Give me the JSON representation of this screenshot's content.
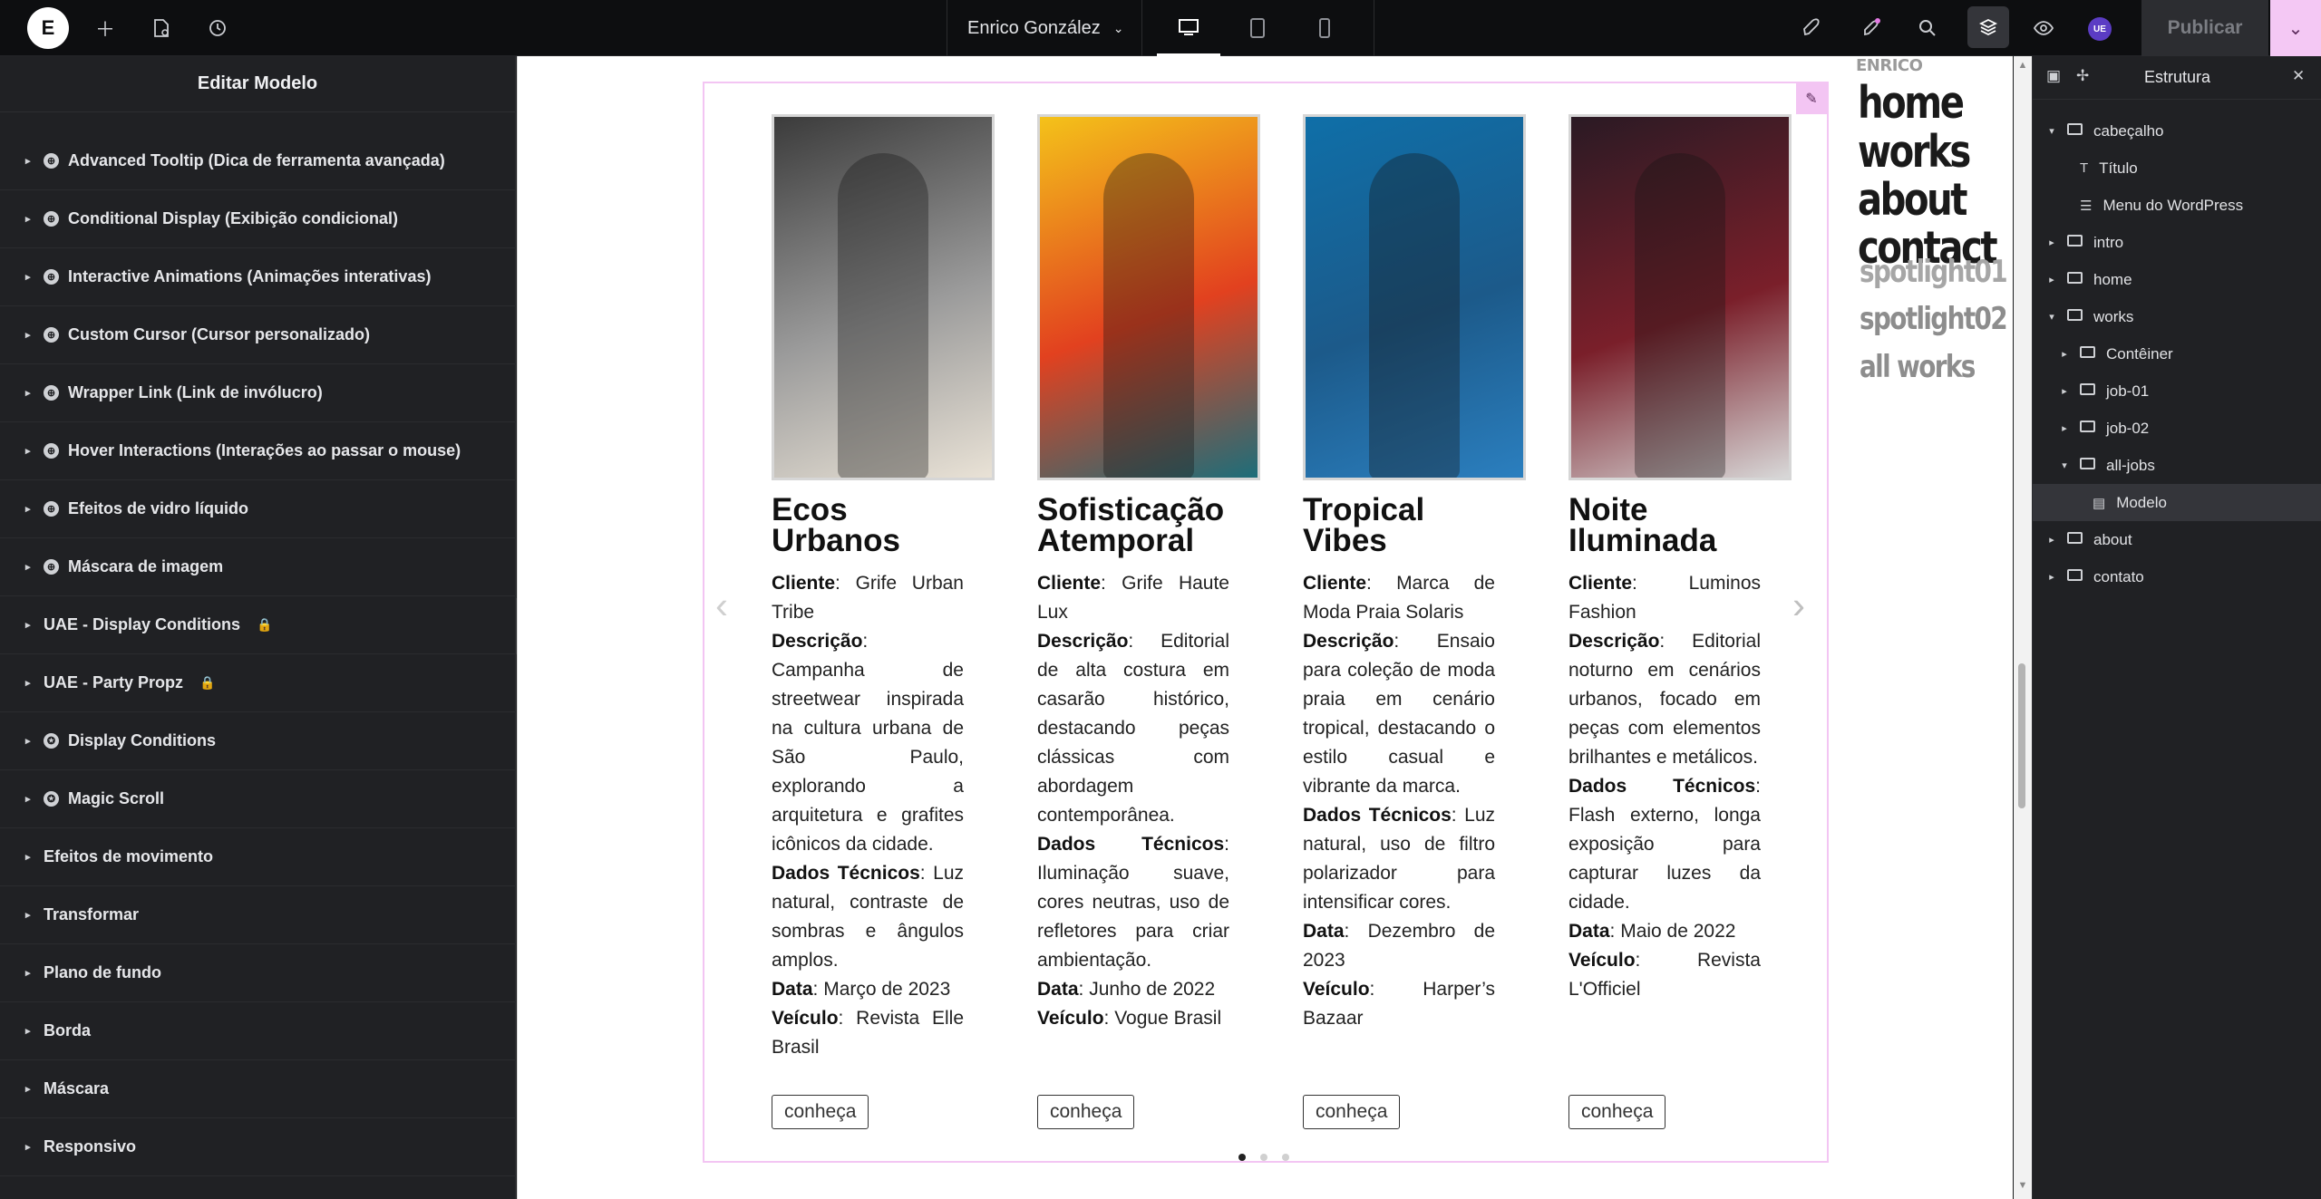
{
  "topbar": {
    "logo": "E",
    "user_name": "Enrico González",
    "publish_label": "Publicar",
    "avatar_initials": "UE"
  },
  "left_panel": {
    "title": "Editar Modelo",
    "sections": [
      {
        "label": "Advanced Tooltip (Dica de ferramenta avançada)",
        "icon": "plugin-icon"
      },
      {
        "label": "Conditional Display (Exibição condicional)",
        "icon": "plugin-icon"
      },
      {
        "label": "Interactive Animations (Animações interativas)",
        "icon": "plugin-icon"
      },
      {
        "label": "Custom Cursor (Cursor personalizado)",
        "icon": "plugin-icon"
      },
      {
        "label": "Wrapper Link (Link de invólucro)",
        "icon": "plugin-icon"
      },
      {
        "label": "Hover Interactions (Interações ao passar o mouse)",
        "icon": "plugin-icon"
      },
      {
        "label": "Efeitos de vidro líquido",
        "icon": "plugin-icon"
      },
      {
        "label": "Máscara de imagem",
        "icon": "plugin-icon"
      },
      {
        "label": "UAE - Display Conditions",
        "icon": "lock-icon"
      },
      {
        "label": "UAE - Party Propz",
        "icon": "lock-icon"
      },
      {
        "label": "Display Conditions",
        "icon": "pro-icon"
      },
      {
        "label": "Magic Scroll",
        "icon": "pro-icon"
      },
      {
        "label": "Efeitos de movimento",
        "icon": ""
      },
      {
        "label": "Transformar",
        "icon": ""
      },
      {
        "label": "Plano de fundo",
        "icon": ""
      },
      {
        "label": "Borda",
        "icon": ""
      },
      {
        "label": "Máscara",
        "icon": ""
      },
      {
        "label": "Responsivo",
        "icon": ""
      }
    ]
  },
  "canvas": {
    "cards": [
      {
        "title": "Ecos Urbanos",
        "lines": [
          {
            "k": "Cliente",
            "v": ": Grife Urban Tribe"
          },
          {
            "k": "Descrição",
            "v": ": Campanha de streetwear inspirada na cultura urbana de São Paulo, explorando a arquitetura e grafites icônicos da cidade."
          },
          {
            "k": "Dados Técnicos",
            "v": ": Luz natural, contraste de sombras e ângulos amplos."
          },
          {
            "k": "Data",
            "v": ": Março de 2023"
          },
          {
            "k": "Veículo",
            "v": ": Revista Elle Brasil"
          }
        ],
        "button": "conheça",
        "palette": [
          "#3b3b3b",
          "#9b9b9b",
          "#e9e2d6"
        ]
      },
      {
        "title": "Sofisticação Atemporal",
        "lines": [
          {
            "k": "Cliente",
            "v": ": Grife Haute Lux"
          },
          {
            "k": "Descrição",
            "v": ": Editorial de alta costura em casarão histórico, destacando peças clássicas com abordagem contemporânea."
          },
          {
            "k": "Dados Técnicos",
            "v": ": Iluminação suave, cores neutras, uso de refletores para criar ambientação."
          },
          {
            "k": "Data",
            "v": ": Junho de 2022"
          },
          {
            "k": "Veículo",
            "v": ": Vogue Brasil"
          }
        ],
        "button": "conheça",
        "palette": [
          "#f4c21a",
          "#e2411f",
          "#1d6e7a"
        ]
      },
      {
        "title": "Tropical Vibes",
        "lines": [
          {
            "k": "Cliente",
            "v": ": Marca de Moda Praia Solaris"
          },
          {
            "k": "Descrição",
            "v": ": Ensaio para coleção de moda praia em cenário tropical, destacando o estilo casual e vibrante da marca."
          },
          {
            "k": "Dados Técnicos",
            "v": ": Luz natural, uso de filtro polarizador para intensificar cores."
          },
          {
            "k": "Data",
            "v": ": Dezembro de 2023"
          },
          {
            "k": "Veículo",
            "v": ": Harper’s Bazaar"
          }
        ],
        "button": "conheça",
        "palette": [
          "#0f6fa8",
          "#1c5a8a",
          "#2b7fbf"
        ]
      },
      {
        "title": "Noite Iluminada",
        "lines": [
          {
            "k": "Cliente",
            "v": ": Luminos Fashion"
          },
          {
            "k": "Descrição",
            "v": ": Editorial noturno em cenários urbanos, focado em peças com elementos brilhantes e metálicos."
          },
          {
            "k": "Dados Técnicos",
            "v": ": Flash externo, longa exposição para capturar luzes da cidade."
          },
          {
            "k": "Data",
            "v": ": Maio de 2022"
          },
          {
            "k": "Veículo",
            "v": ": Revista L'Officiel"
          }
        ],
        "button": "conheça",
        "palette": [
          "#2a1a24",
          "#7a1f2a",
          "#d8d8d8"
        ]
      }
    ],
    "sidenav": {
      "brand": "ENRICO",
      "links": [
        "home",
        "works",
        "about",
        "contact"
      ],
      "spotlights": [
        "spotlight01",
        "spotlight02",
        "all works"
      ]
    }
  },
  "right_panel": {
    "title": "Estrutura",
    "tree": [
      {
        "label": "cabeçalho",
        "level": 0,
        "expanded": true,
        "icon": "container-icon"
      },
      {
        "label": "Título",
        "level": 1,
        "expanded": null,
        "icon": "heading-icon"
      },
      {
        "label": "Menu do WordPress",
        "level": 1,
        "expanded": null,
        "icon": "menu-icon"
      },
      {
        "label": "intro",
        "level": 0,
        "expanded": false,
        "icon": "container-icon"
      },
      {
        "label": "home",
        "level": 0,
        "expanded": false,
        "icon": "container-icon"
      },
      {
        "label": "works",
        "level": 0,
        "expanded": true,
        "icon": "container-icon"
      },
      {
        "label": "Contêiner",
        "level": 1,
        "expanded": false,
        "icon": "container-icon"
      },
      {
        "label": "job-01",
        "level": 1,
        "expanded": false,
        "icon": "container-icon"
      },
      {
        "label": "job-02",
        "level": 1,
        "expanded": false,
        "icon": "container-icon"
      },
      {
        "label": "all-jobs",
        "level": 1,
        "expanded": true,
        "icon": "container-icon"
      },
      {
        "label": "Modelo",
        "level": 2,
        "expanded": null,
        "icon": "template-icon"
      },
      {
        "label": "about",
        "level": 0,
        "expanded": false,
        "icon": "container-icon"
      },
      {
        "label": "contato",
        "level": 0,
        "expanded": false,
        "icon": "container-icon"
      }
    ]
  }
}
